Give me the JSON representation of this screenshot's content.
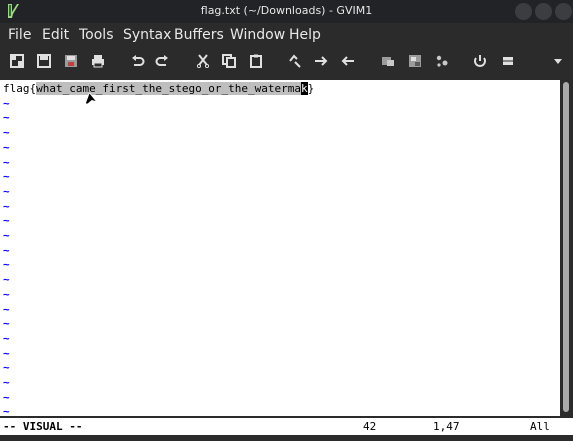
{
  "window": {
    "title": "flag.txt (~/Downloads) - GVIM1"
  },
  "menubar": {
    "items": [
      "File",
      "Edit",
      "Tools",
      "Syntax",
      "Buffers",
      "Window",
      "Help"
    ]
  },
  "toolbar": {
    "buttons": [
      "open-icon",
      "save-icon",
      "save-all-icon",
      "print-icon",
      "undo-icon",
      "redo-icon",
      "cut-icon",
      "copy-icon",
      "paste-icon",
      "replace-icon",
      "find-next-icon",
      "find-prev-icon",
      "load-session-icon",
      "save-session-icon",
      "run-script-icon",
      "make-icon",
      "tags-icon",
      "overflow-icon"
    ]
  },
  "editor": {
    "line_prefix": "flag{",
    "selected_text": "what_came_first_the_stego_or_the_waterma",
    "cursor_char": "k",
    "line_suffix": "}",
    "tilde": "~"
  },
  "statusline": {
    "mode": "-- VISUAL --",
    "selection_count": "42",
    "position": "1,47",
    "percent": "All"
  },
  "colors": {
    "tilde": "#0000ff",
    "selection": "#bebebe",
    "chrome": "#2b2b2b"
  }
}
